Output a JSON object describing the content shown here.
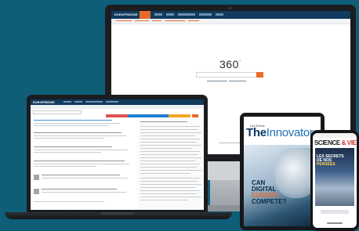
{
  "monitor": {
    "app_logo": "EUROPRESSE",
    "logo_text": "360",
    "logo_mark": "°"
  },
  "laptop": {
    "app_logo": "EUROPRESSE"
  },
  "tablet": {
    "magazine_brand": "Les Echos",
    "magazine_title_bold": "The",
    "magazine_title_light": "Innovator",
    "headline_line1": "CAN",
    "headline_line2": "DIGITAL",
    "headline_line3": "EUROPE",
    "headline_line4": "COMPETE?"
  },
  "phone": {
    "magazine_title_a": "SCIENCE",
    "magazine_title_b": "& VIE",
    "cover_line1": "LES SECRETS",
    "cover_line2": "DE NOS",
    "cover_line3": "PENSÉES"
  },
  "colors": {
    "background": "#0e5e78",
    "brand_navy": "#103a5e",
    "accent_orange": "#e86a2a"
  }
}
